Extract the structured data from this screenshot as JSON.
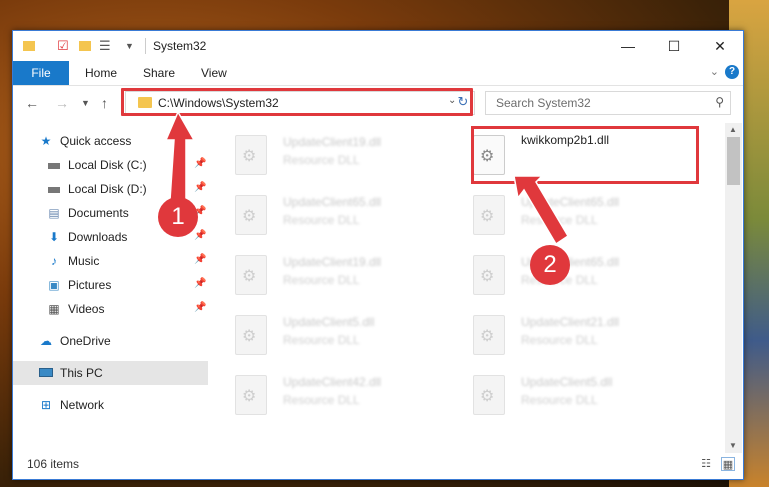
{
  "window": {
    "title": "System32",
    "controls": {
      "minimize": "—",
      "maximize": "☐",
      "close": "✕"
    }
  },
  "ribbon": {
    "tabs": [
      "File",
      "Home",
      "Share",
      "View"
    ],
    "help": "?"
  },
  "address_bar": {
    "path": "C:\\Windows\\System32",
    "search_placeholder": "Search System32"
  },
  "sidebar": {
    "items": [
      {
        "label": "Quick access",
        "icon": "star-icon",
        "pinned": false
      },
      {
        "label": "Local Disk (C:)",
        "icon": "drive-icon",
        "pinned": true
      },
      {
        "label": "Local Disk (D:)",
        "icon": "drive-icon",
        "pinned": true
      },
      {
        "label": "Documents",
        "icon": "documents-icon",
        "pinned": true
      },
      {
        "label": "Downloads",
        "icon": "download-icon",
        "pinned": true
      },
      {
        "label": "Music",
        "icon": "music-icon",
        "pinned": true
      },
      {
        "label": "Pictures",
        "icon": "pictures-icon",
        "pinned": true
      },
      {
        "label": "Videos",
        "icon": "videos-icon",
        "pinned": true
      },
      {
        "label": "OneDrive",
        "icon": "cloud-icon",
        "pinned": false
      },
      {
        "label": "This PC",
        "icon": "computer-icon",
        "pinned": false,
        "selected": true
      },
      {
        "label": "Network",
        "icon": "network-icon",
        "pinned": false
      }
    ]
  },
  "files": [
    {
      "name": "UpdateClient19.dll",
      "type": "Resource DLL"
    },
    {
      "name": "kwikkomp2b1.dll",
      "type": ""
    },
    {
      "name": "UpdateClient65.dll",
      "type": "Resource DLL"
    },
    {
      "name": "UpdateClient65.dll",
      "type": "Resource DLL"
    },
    {
      "name": "UpdateClient19.dll",
      "type": "Resource DLL"
    },
    {
      "name": "UpdateClient65.dll",
      "type": "Resource DLL"
    },
    {
      "name": "UpdateClient5.dll",
      "type": "Resource DLL"
    },
    {
      "name": "UpdateClient21.dll",
      "type": "Resource DLL"
    },
    {
      "name": "UpdateClient42.dll",
      "type": "Resource DLL"
    },
    {
      "name": "UpdateClient5.dll",
      "type": "Resource DLL"
    }
  ],
  "status": {
    "item_count": "106 items"
  },
  "annotations": {
    "step1": "1",
    "step2": "2"
  },
  "colors": {
    "accent": "#1979ca",
    "highlight": "#e0383c"
  }
}
